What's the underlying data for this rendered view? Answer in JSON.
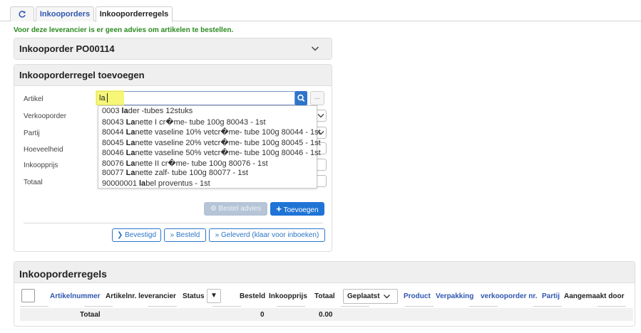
{
  "tabs": [
    {
      "icon": "refresh-icon"
    },
    {
      "label": "Inkooporders"
    },
    {
      "label": "Inkooporderregels"
    }
  ],
  "advice_message": "Voor deze leverancier is er geen advies om artikelen te bestellen.",
  "order_panel": {
    "title": "Inkooporder PO00114"
  },
  "add_panel": {
    "title": "Inkooporderregel toevoegen",
    "labels": {
      "artikel": "Artikel",
      "verkooporder": "Verkooporder",
      "partij": "Partij",
      "hoeveelheid": "Hoeveelheid",
      "inkoopprijs": "Inkoopprijs",
      "totaal": "Totaal"
    },
    "search_value": "la",
    "more_label": "...",
    "autocomplete": [
      {
        "pre": "0003 ",
        "match": "la",
        "post": "der -tubes 12stuks"
      },
      {
        "pre": "80043 ",
        "match": "La",
        "post": "nette I cr�me- tube 100g 80043 - 1st"
      },
      {
        "pre": "80044 ",
        "match": "La",
        "post": "nette vaseline 10% vetcr�me- tube 100g 80044 - 1st"
      },
      {
        "pre": "80045 ",
        "match": "La",
        "post": "nette vaseline 20% vetcr�me- tube 100g 80045 - 1st"
      },
      {
        "pre": "80046 ",
        "match": "La",
        "post": "nette vaseline 50% vetcr�me- tube 100g 80046 - 1st"
      },
      {
        "pre": "80076 ",
        "match": "La",
        "post": "nette II cr�me- tube 100g 80076 - 1st"
      },
      {
        "pre": "80077 ",
        "match": "La",
        "post": "nette zalf- tube 100g 80077 - 1st"
      },
      {
        "pre": "90000001 ",
        "match": "la",
        "post": "bel proventus - 1st"
      }
    ],
    "buttons": {
      "advice": "Bestel advies",
      "add": "Toevoegen",
      "confirmed": "Bevestigd",
      "ordered": "Besteld",
      "delivered": "Geleverd (klaar voor inboeken)"
    }
  },
  "lines_panel": {
    "title": "Inkooporderregels",
    "columns": {
      "artikelnummer": "Artikelnummer",
      "artikelnr_leverancier": "Artikelnr. leverancier",
      "status": "Status",
      "status_sort": "▼",
      "besteld": "Besteld",
      "inkoopprijs": "Inkoopprijs",
      "totaal": "Totaal",
      "geplaatst": "Geplaatst",
      "product": "Product",
      "verpakking": "Verpakking",
      "verkooporder_nr": "verkooporder nr.",
      "partij": "Partij",
      "aangemaakt_door": "Aangemaakt door"
    },
    "totals": {
      "label": "Totaal",
      "besteld": "0",
      "totaal": "0.00"
    }
  },
  "colors": {
    "accent": "#2c76c9",
    "link": "#2f56b0",
    "success": "#2a8a1f",
    "highlight": "#f5f560"
  }
}
